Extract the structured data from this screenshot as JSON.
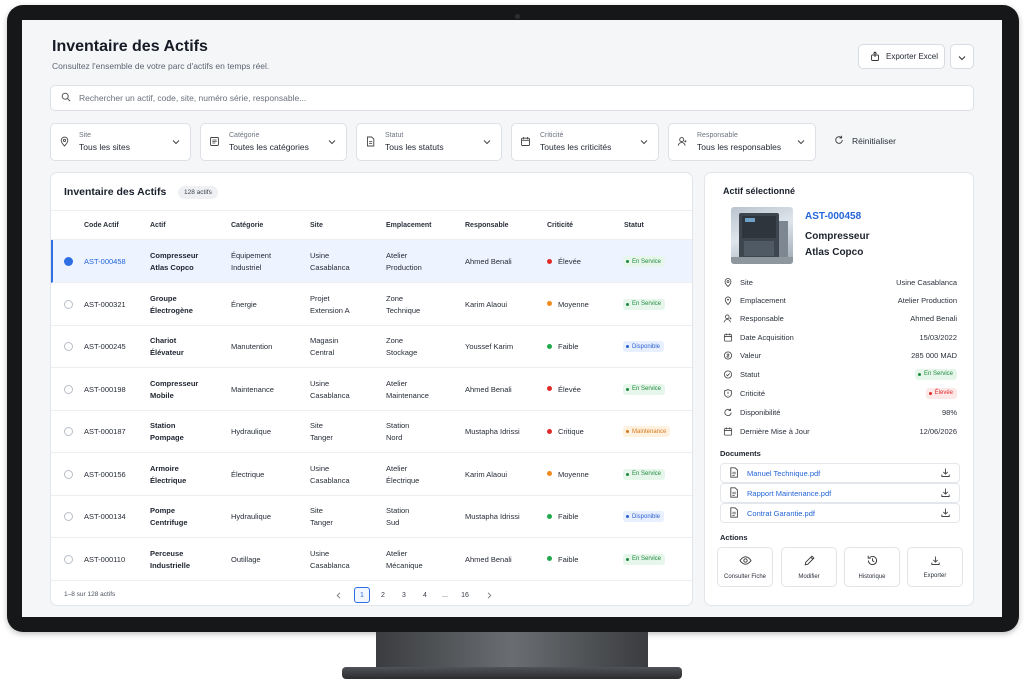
{
  "header": {
    "title": "Inventaire des Actifs",
    "subtitle": "Consultez l'ensemble de votre parc d'actifs en temps réel.",
    "export_label": "Exporter Excel"
  },
  "search": {
    "placeholder": "Rechercher un actif, code, site, numéro série, responsable..."
  },
  "filters": [
    {
      "label": "Site",
      "value": "Tous les sites",
      "icon": "map-pin-icon"
    },
    {
      "label": "Catégorie",
      "value": "Toutes les catégories",
      "icon": "category-icon"
    },
    {
      "label": "Statut",
      "value": "Tous les statuts",
      "icon": "document-icon"
    },
    {
      "label": "Criticité",
      "value": "Toutes les criticités",
      "icon": "calendar-icon"
    },
    {
      "label": "Responsable",
      "value": "Tous les responsables",
      "icon": "user-icon"
    }
  ],
  "reset_label": "Réinitialiser",
  "table": {
    "title": "Inventaire des Actifs",
    "count": "128 actifs",
    "columns": [
      "Code Actif",
      "Actif",
      "Catégorie",
      "Site",
      "Emplacement",
      "Responsable",
      "Criticité",
      "Statut"
    ],
    "rows": [
      {
        "code": "AST-000458",
        "asset": [
          "Compresseur",
          "Atlas Copco"
        ],
        "category": [
          "Équipement",
          "Industriel"
        ],
        "site": [
          "Usine",
          "Casablanca"
        ],
        "location": [
          "Atelier",
          "Production"
        ],
        "owner": "Ahmed Benali",
        "criticality": "Élevée",
        "status": "En Service"
      },
      {
        "code": "AST-000321",
        "asset": [
          "Groupe",
          "Électrogène"
        ],
        "category": [
          "Énergie"
        ],
        "site": [
          "Projet",
          "Extension A"
        ],
        "location": [
          "Zone",
          "Technique"
        ],
        "owner": "Karim Alaoui",
        "criticality": "Moyenne",
        "status": "En Service"
      },
      {
        "code": "AST-000245",
        "asset": [
          "Chariot",
          "Élévateur"
        ],
        "category": [
          "Manutention"
        ],
        "site": [
          "Magasin",
          "Central"
        ],
        "location": [
          "Zone",
          "Stockage"
        ],
        "owner": "Youssef Karim",
        "criticality": "Faible",
        "status": "Disponible"
      },
      {
        "code": "AST-000198",
        "asset": [
          "Compresseur",
          "Mobile"
        ],
        "category": [
          "Maintenance"
        ],
        "site": [
          "Usine",
          "Casablanca"
        ],
        "location": [
          "Atelier",
          "Maintenance"
        ],
        "owner": "Ahmed Benali",
        "criticality": "Élevée",
        "status": "En Service"
      },
      {
        "code": "AST-000187",
        "asset": [
          "Station",
          "Pompage"
        ],
        "category": [
          "Hydraulique"
        ],
        "site": [
          "Site",
          "Tanger"
        ],
        "location": [
          "Station",
          "Nord"
        ],
        "owner": "Mustapha Idrissi",
        "criticality": "Critique",
        "status": "Maintenance"
      },
      {
        "code": "AST-000156",
        "asset": [
          "Armoire",
          "Électrique"
        ],
        "category": [
          "Électrique"
        ],
        "site": [
          "Usine",
          "Casablanca"
        ],
        "location": [
          "Atelier",
          "Électrique"
        ],
        "owner": "Karim Alaoui",
        "criticality": "Moyenne",
        "status": "En Service"
      },
      {
        "code": "AST-000134",
        "asset": [
          "Pompe",
          "Centrifuge"
        ],
        "category": [
          "Hydraulique"
        ],
        "site": [
          "Site",
          "Tanger"
        ],
        "location": [
          "Station",
          "Sud"
        ],
        "owner": "Mustapha Idrissi",
        "criticality": "Faible",
        "status": "Disponible"
      },
      {
        "code": "AST-000110",
        "asset": [
          "Perceuse",
          "Industrielle"
        ],
        "category": [
          "Outillage"
        ],
        "site": [
          "Usine",
          "Casablanca"
        ],
        "location": [
          "Atelier",
          "Mécanique"
        ],
        "owner": "Ahmed Benali",
        "criticality": "Faible",
        "status": "En Service"
      }
    ],
    "pagination": {
      "info": "1–8 sur 128 actifs",
      "pages": [
        "1",
        "2",
        "3",
        "4",
        "...",
        "16"
      ],
      "current": "1"
    }
  },
  "detail": {
    "title": "Actif sélectionné",
    "code": "AST-000458",
    "name": "Compresseur Atlas Copco",
    "fields": [
      {
        "label": "Site",
        "value": "Usine Casablanca",
        "icon": "map-pin-icon"
      },
      {
        "label": "Emplacement",
        "value": "Atelier Production",
        "icon": "location-icon"
      },
      {
        "label": "Responsable",
        "value": "Ahmed Benali",
        "icon": "user-icon"
      },
      {
        "label": "Date Acquisition",
        "value": "15/03/2022",
        "icon": "calendar-icon"
      },
      {
        "label": "Valeur",
        "value": "285 000 MAD",
        "icon": "coin-icon"
      },
      {
        "label": "Statut",
        "value": "En Service",
        "icon": "status-icon"
      },
      {
        "label": "Criticité",
        "value": "Élevée",
        "icon": "alert-icon"
      },
      {
        "label": "Disponibilité",
        "value": "98%",
        "icon": "refresh-icon"
      },
      {
        "label": "Dernière Mise à Jour",
        "value": "12/06/2026",
        "icon": "calendar-icon"
      }
    ],
    "documents_title": "Documents",
    "documents": [
      "Manuel Technique.pdf",
      "Rapport Maintenance.pdf",
      "Contrat Garantie.pdf"
    ],
    "actions_title": "Actions",
    "actions": [
      {
        "label": "Consulter Fiche",
        "icon": "eye-icon"
      },
      {
        "label": "Modifier",
        "icon": "pencil-icon"
      },
      {
        "label": "Historique",
        "icon": "history-icon"
      },
      {
        "label": "Exporter",
        "icon": "download-icon"
      }
    ]
  },
  "colors": {
    "accent": "#2f6fe4",
    "link": "#2465d8",
    "crit_high": "#e02b2b",
    "crit_medium": "#f08a1c",
    "crit_low": "#22a84f",
    "crit_critical": "#e02b2b",
    "status_service_bg": "#e6f6ea",
    "status_service_fg": "#1f8a3f",
    "status_dispo_bg": "#e8f0ff",
    "status_dispo_fg": "#2a5fd0",
    "status_maint_bg": "#fff1e0",
    "status_maint_fg": "#d6791a"
  }
}
